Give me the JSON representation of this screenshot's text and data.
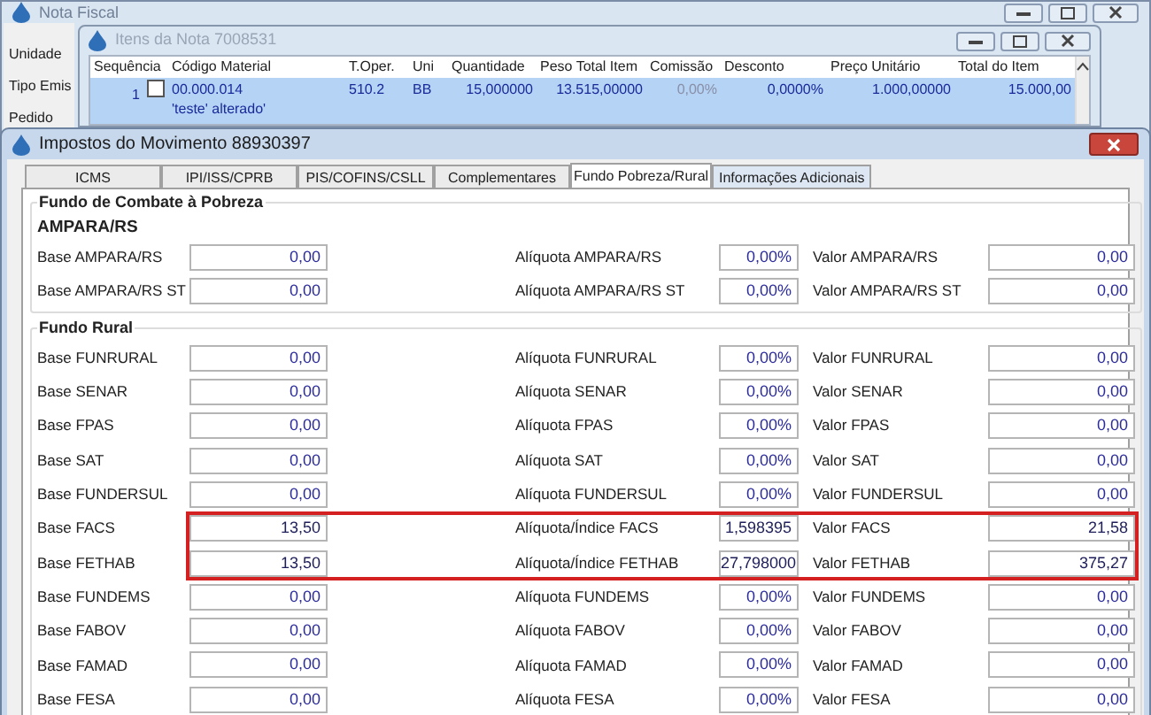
{
  "back_window": {
    "title": "Nota Fiscal",
    "fields": [
      "Unidade",
      "Tipo Emis",
      "Pedido"
    ]
  },
  "items_window": {
    "title": "Itens da Nota 7008531",
    "columns": [
      "Sequência",
      "Código Material",
      "T.Oper.",
      "Uni",
      "Quantidade",
      "Peso Total Item",
      "Comissão",
      "Desconto",
      "Preço Unitário",
      "Total do Item"
    ],
    "rows": [
      {
        "selected": true,
        "checked": false,
        "sequence": "1",
        "code": "00.000.014",
        "description": "'teste' alterado'",
        "operation": "510.2",
        "unit": "BB",
        "quantity": "15,000000",
        "weight": "13.515,00000",
        "commission": "0,00%",
        "discount": "0,0000%",
        "unit_price": "1.000,00000",
        "total": "15.000,00"
      }
    ]
  },
  "tax_window": {
    "title": "Impostos do Movimento 88930397",
    "tabs": [
      {
        "label": "ICMS",
        "selected": false
      },
      {
        "label": "IPI/ISS/CPRB",
        "selected": false
      },
      {
        "label": "PIS/COFINS/CSLL",
        "selected": false
      },
      {
        "label": "Complementares",
        "selected": false
      },
      {
        "label": "Fundo Pobreza/Rural",
        "selected": true
      },
      {
        "label": "Informações Adicionais",
        "selected": false
      }
    ],
    "groups": [
      {
        "title": "Fundo de Combate à Pobreza",
        "subtitle": "AMPARA/RS",
        "rows": [
          {
            "label": "Base AMPARA/RS",
            "base": "0,00",
            "rate_label": "Alíquota AMPARA/RS",
            "rate": "0,00%",
            "value_label": "Valor AMPARA/RS",
            "value": "0,00",
            "highlighted": false
          },
          {
            "label": "Base AMPARA/RS ST",
            "base": "0,00",
            "rate_label": "Alíquota AMPARA/RS ST",
            "rate": "0,00%",
            "value_label": "Valor AMPARA/RS ST",
            "value": "0,00",
            "highlighted": false
          }
        ]
      },
      {
        "title": "Fundo Rural",
        "rows": [
          {
            "label": "Base FUNRURAL",
            "base": "0,00",
            "rate_label": "Alíquota FUNRURAL",
            "rate": "0,00%",
            "value_label": "Valor FUNRURAL",
            "value": "0,00",
            "highlighted": false
          },
          {
            "label": "Base SENAR",
            "base": "0,00",
            "rate_label": "Alíquota SENAR",
            "rate": "0,00%",
            "value_label": "Valor SENAR",
            "value": "0,00",
            "highlighted": false
          },
          {
            "label": "Base FPAS",
            "base": "0,00",
            "rate_label": "Alíquota FPAS",
            "rate": "0,00%",
            "value_label": "Valor FPAS",
            "value": "0,00",
            "highlighted": false
          },
          {
            "label": "Base SAT",
            "base": "0,00",
            "rate_label": "Alíquota SAT",
            "rate": "0,00%",
            "value_label": "Valor SAT",
            "value": "0,00",
            "highlighted": false
          },
          {
            "label": "Base FUNDERSUL",
            "base": "0,00",
            "rate_label": "Alíquota FUNDERSUL",
            "rate": "0,00%",
            "value_label": "Valor FUNDERSUL",
            "value": "0,00",
            "highlighted": false
          },
          {
            "label": "Base FACS",
            "base": "13,50",
            "rate_label": "Alíquota/Índice FACS",
            "rate": "1,598395",
            "value_label": "Valor FACS",
            "value": "21,58",
            "highlighted": true
          },
          {
            "label": "Base FETHAB",
            "base": "13,50",
            "rate_label": "Alíquota/Índice FETHAB",
            "rate": "27,798000",
            "value_label": "Valor FETHAB",
            "value": "375,27",
            "highlighted": true
          },
          {
            "label": "Base FUNDEMS",
            "base": "0,00",
            "rate_label": "Alíquota FUNDEMS",
            "rate": "0,00%",
            "value_label": "Valor FUNDEMS",
            "value": "0,00",
            "highlighted": false
          },
          {
            "label": "Base FABOV",
            "base": "0,00",
            "rate_label": "Alíquota FABOV",
            "rate": "0,00%",
            "value_label": "Valor FABOV",
            "value": "0,00",
            "highlighted": false
          },
          {
            "label": "Base FAMAD",
            "base": "0,00",
            "rate_label": "Alíquota FAMAD",
            "rate": "0,00%",
            "value_label": "Valor FAMAD",
            "value": "0,00",
            "highlighted": false
          },
          {
            "label": "Base FESA",
            "base": "0,00",
            "rate_label": "Alíquota FESA",
            "rate": "0,00%",
            "value_label": "Valor FESA",
            "value": "0,00",
            "highlighted": false
          }
        ]
      }
    ]
  }
}
